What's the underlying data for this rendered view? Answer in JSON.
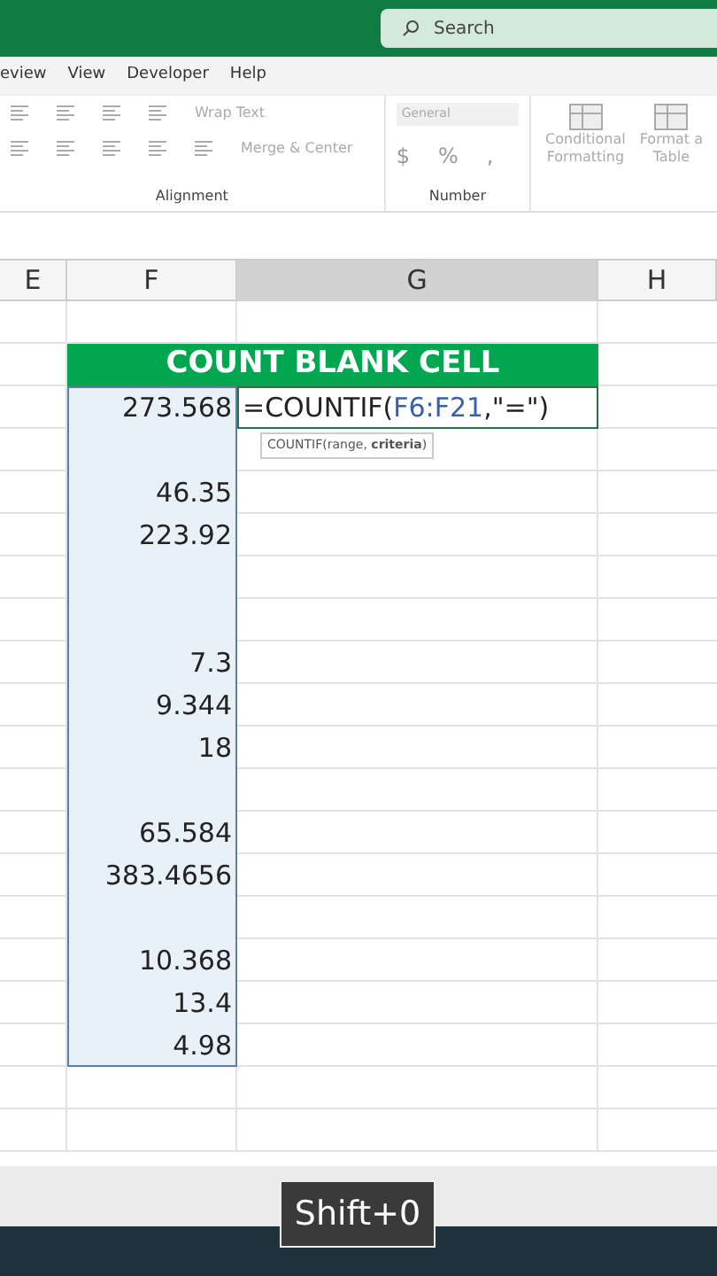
{
  "title_bar": {
    "search": {
      "placeholder": "Search"
    }
  },
  "ribbon_tabs": [
    {
      "label": "eview"
    },
    {
      "label": "View"
    },
    {
      "label": "Developer"
    },
    {
      "label": "Help"
    }
  ],
  "ribbon": {
    "wrap_text": "Wrap Text",
    "merge_center": "Merge & Center",
    "number_format": "General",
    "currency": "$",
    "percent": "%",
    "comma": ",",
    "conditional_formatting": [
      "Conditional",
      "Formatting"
    ],
    "format_table": [
      "Format a",
      "Table"
    ],
    "groups": [
      "Alignment",
      "Number"
    ]
  },
  "columns": [
    {
      "label": "E",
      "selected": false
    },
    {
      "label": "F",
      "selected": false
    },
    {
      "label": "G",
      "selected": true
    },
    {
      "label": "H",
      "selected": false
    }
  ],
  "sheet": {
    "title": "COUNT BLANK CELL",
    "formula": {
      "start": "=COUNTIF(",
      "reference": "F6:F21",
      "end": ",\"=\")"
    },
    "tooltip": "COUNTIF(range, **criteria**)",
    "rows": [
      {
        "f": "273.568"
      },
      {},
      {
        "f": "46.35"
      },
      {
        "f": "223.92"
      },
      {},
      {},
      {
        "f": "7.3"
      },
      {
        "f": "9.344"
      },
      {
        "f": "18"
      },
      {},
      {
        "f": "65.584"
      },
      {
        "f": "383.4656"
      },
      {},
      {
        "f": "10.368"
      },
      {
        "f": "13.4"
      },
      {
        "f": "4.98"
      }
    ]
  },
  "key_overlay": "Shift+0"
}
